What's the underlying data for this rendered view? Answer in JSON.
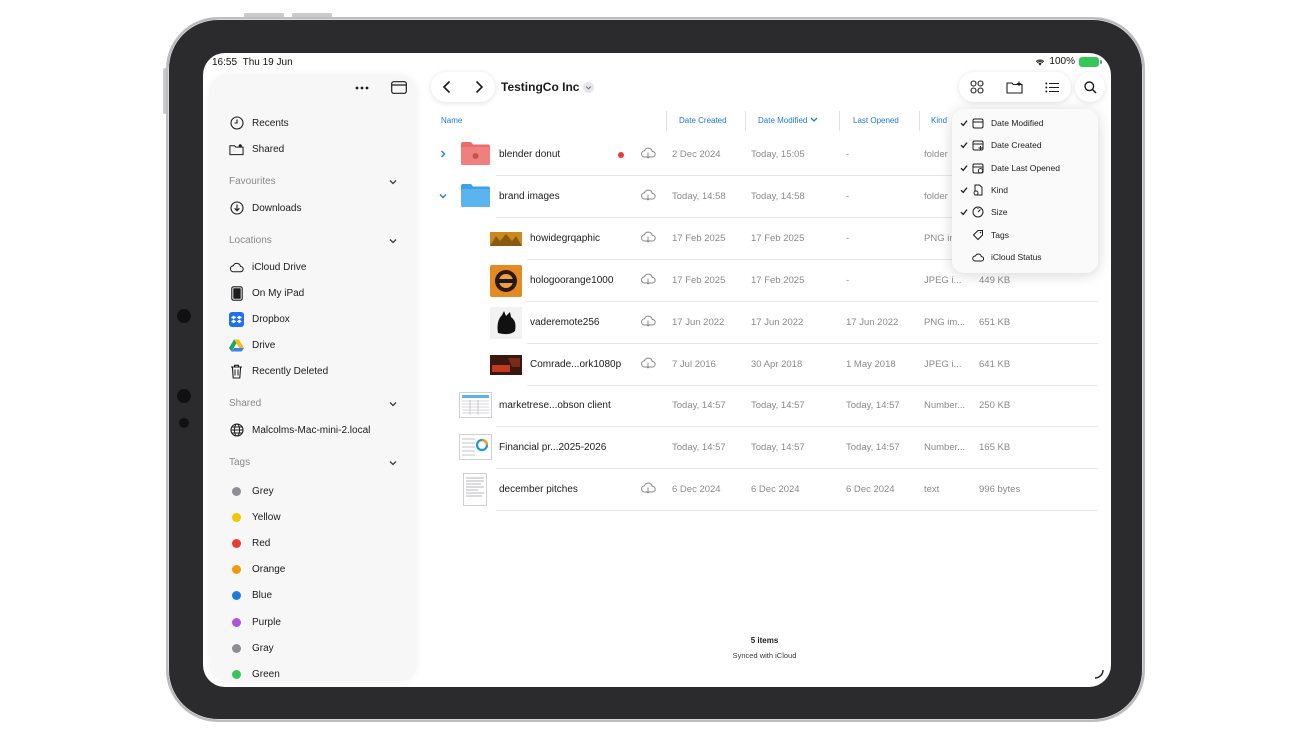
{
  "status_bar": {
    "time": "16:55",
    "date": "Thu 19 Jun",
    "battery": "100%"
  },
  "sidebar": {
    "favourites_top": [
      {
        "label": "Recents",
        "icon": "clock-icon"
      },
      {
        "label": "Shared",
        "icon": "shared-folder-icon"
      }
    ],
    "sections": {
      "favourites": "Favourites",
      "locations": "Locations",
      "shared": "Shared",
      "tags": "Tags"
    },
    "favourites": [
      {
        "label": "Downloads",
        "icon": "download-icon"
      }
    ],
    "locations": [
      {
        "label": "iCloud Drive",
        "icon": "cloud-icon"
      },
      {
        "label": "On My iPad",
        "icon": "ipad-icon"
      },
      {
        "label": "Dropbox",
        "icon": "dropbox-icon"
      },
      {
        "label": "Drive",
        "icon": "google-drive-icon"
      },
      {
        "label": "Recently Deleted",
        "icon": "trash-icon"
      }
    ],
    "shared": [
      {
        "label": "Malcolms-Mac-mini-2.local",
        "icon": "globe-icon"
      }
    ],
    "tags": [
      {
        "label": "Grey",
        "color": "#8e8e93"
      },
      {
        "label": "Yellow",
        "color": "#f7c400"
      },
      {
        "label": "Red",
        "color": "#ea3b31"
      },
      {
        "label": "Orange",
        "color": "#f39a0b"
      },
      {
        "label": "Blue",
        "color": "#1e7ae0"
      },
      {
        "label": "Purple",
        "color": "#af52de"
      },
      {
        "label": "Gray",
        "color": "#8e8e93"
      },
      {
        "label": "Green",
        "color": "#34c759"
      }
    ]
  },
  "toolbar": {
    "folder_title": "TestingCo Inc"
  },
  "columns": {
    "name": "Name",
    "date_created": "Date Created",
    "date_modified": "Date Modified",
    "last_opened": "Last Opened",
    "kind": "Kind"
  },
  "rows": [
    {
      "name": "blender donut",
      "created": "2 Dec 2024",
      "modified": "Today, 15:05",
      "opened": "-",
      "kind": "folder",
      "size": ""
    },
    {
      "name": "brand images",
      "created": "Today, 14:58",
      "modified": "Today, 14:58",
      "opened": "-",
      "kind": "folder",
      "size": ""
    },
    {
      "name": "howidegrqaphic",
      "created": "17 Feb 2025",
      "modified": "17 Feb 2025",
      "opened": "-",
      "kind": "PNG in",
      "size": ""
    },
    {
      "name": "hologoorange1000",
      "created": "17 Feb 2025",
      "modified": "17 Feb 2025",
      "opened": "-",
      "kind": "JPEG i...",
      "size": "449 KB"
    },
    {
      "name": "vaderemote256",
      "created": "17 Jun 2022",
      "modified": "17 Jun 2022",
      "opened": "17 Jun 2022",
      "kind": "PNG im...",
      "size": "651 KB"
    },
    {
      "name": "Comrade...ork1080p",
      "created": "7 Jul 2016",
      "modified": "30 Apr 2018",
      "opened": "1 May 2018",
      "kind": "JPEG i...",
      "size": "641 KB"
    },
    {
      "name": "marketrese...obson client",
      "created": "Today, 14:57",
      "modified": "Today, 14:57",
      "opened": "Today, 14:57",
      "kind": "Number...",
      "size": "250 KB"
    },
    {
      "name": "Financial pr...2025-2026",
      "created": "Today, 14:57",
      "modified": "Today, 14:57",
      "opened": "Today, 14:57",
      "kind": "Number...",
      "size": "165 KB"
    },
    {
      "name": "december pitches",
      "created": "6 Dec 2024",
      "modified": "6 Dec 2024",
      "opened": "6 Dec 2024",
      "kind": "text",
      "size": "996 bytes"
    }
  ],
  "footer": {
    "count": "5 items",
    "sync": "Synced with iCloud"
  },
  "column_menu": [
    {
      "label": "Date Modified",
      "checked": true,
      "icon": "calendar-icon"
    },
    {
      "label": "Date Created",
      "checked": true,
      "icon": "calendar-plus-icon"
    },
    {
      "label": "Date Last Opened",
      "checked": true,
      "icon": "calendar-clock-icon"
    },
    {
      "label": "Kind",
      "checked": true,
      "icon": "document-icon"
    },
    {
      "label": "Size",
      "checked": true,
      "icon": "gauge-icon"
    },
    {
      "label": "Tags",
      "checked": false,
      "icon": "tag-icon"
    },
    {
      "label": "iCloud Status",
      "checked": false,
      "icon": "cloud-icon"
    }
  ],
  "colors": {
    "accent": "#1e7ae0",
    "folder_blue": "#5ab4ee",
    "folder_red": "#ee6b6b"
  }
}
